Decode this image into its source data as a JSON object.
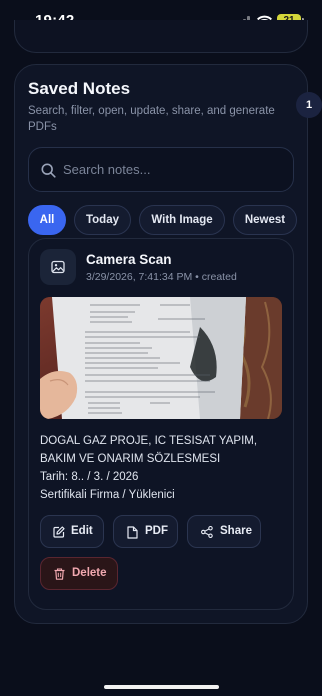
{
  "status_bar": {
    "time": "19:42",
    "battery": "21"
  },
  "saved_notes": {
    "title": "Saved Notes",
    "subtitle": "Search, filter, open, update, share, and generate PDFs",
    "count_badge": "1",
    "search": {
      "placeholder": "Search notes...",
      "value": ""
    },
    "filters": [
      {
        "label": "All",
        "active": true
      },
      {
        "label": "Today",
        "active": false
      },
      {
        "label": "With Image",
        "active": false
      },
      {
        "label": "Newest",
        "active": false
      }
    ]
  },
  "note": {
    "title": "Camera Scan",
    "meta": "3/29/2026, 7:41:34 PM • created",
    "lines": [
      "DOGAL GAZ PROJE, IC TESISAT YAPIM,",
      "BAKIM VE ONARIM SÖZLESMESI",
      "Tarih: 8.. / 3. / 2026",
      "Sertifikali Firma / Yüklenici"
    ],
    "actions": {
      "edit": "Edit",
      "pdf": "PDF",
      "share": "Share",
      "delete": "Delete"
    }
  },
  "colors": {
    "accent": "#3a66f0",
    "background": "#0a0e1b",
    "danger": "#f1a8b0"
  }
}
